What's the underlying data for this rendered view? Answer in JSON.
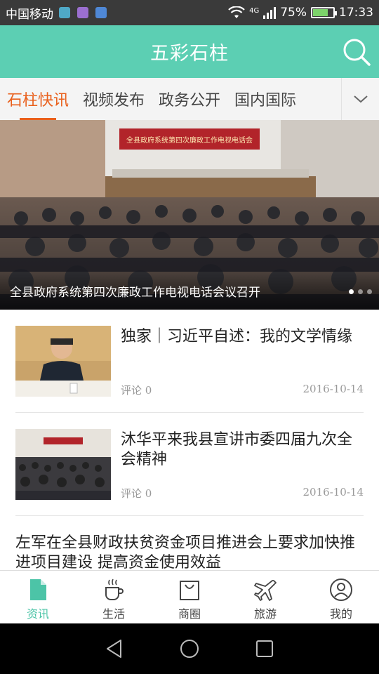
{
  "status_bar": {
    "carrier": "中国移动",
    "network": "4G",
    "battery": "75%",
    "battery_level": 0.75,
    "time": "17:33",
    "notification_icons": [
      "app-notification-icon",
      "gallery-notification-icon",
      "sim-notification-icon"
    ]
  },
  "header": {
    "title": "五彩石柱",
    "search_icon": "search-icon"
  },
  "tabs": {
    "items": [
      "石柱快讯",
      "视频发布",
      "政务公开",
      "国内国际"
    ],
    "active_index": 0,
    "more_icon": "chevron-down-icon"
  },
  "banner": {
    "image_sign": "全县政府系统第四次廉政工作电视电话会",
    "caption": "全县政府系统第四次廉政工作电视电话会议召开",
    "slide_count": 3,
    "active_slide": 0
  },
  "news": [
    {
      "title": "独家｜习近平自述：我的文学情缘",
      "comments": "评论 0",
      "date": "2016-10-14",
      "has_thumb": true
    },
    {
      "title": "沐华平来我县宣讲市委四届九次全会精神",
      "comments": "评论 0",
      "date": "2016-10-14",
      "has_thumb": true
    },
    {
      "title": "左军在全县财政扶贫资金项目推进会上要求加快推进项目建设 提高资金使用效益",
      "has_thumb": false
    }
  ],
  "bottom_nav": {
    "items": [
      {
        "label": "资讯",
        "icon": "document-icon"
      },
      {
        "label": "生活",
        "icon": "coffee-cup-icon"
      },
      {
        "label": "商圈",
        "icon": "shopping-bag-icon"
      },
      {
        "label": "旅游",
        "icon": "airplane-icon"
      },
      {
        "label": "我的",
        "icon": "user-icon"
      }
    ],
    "active_index": 0
  },
  "colors": {
    "brand": "#5ccfb3",
    "active_tab": "#e9601c",
    "active_nav": "#4cc4a7"
  }
}
